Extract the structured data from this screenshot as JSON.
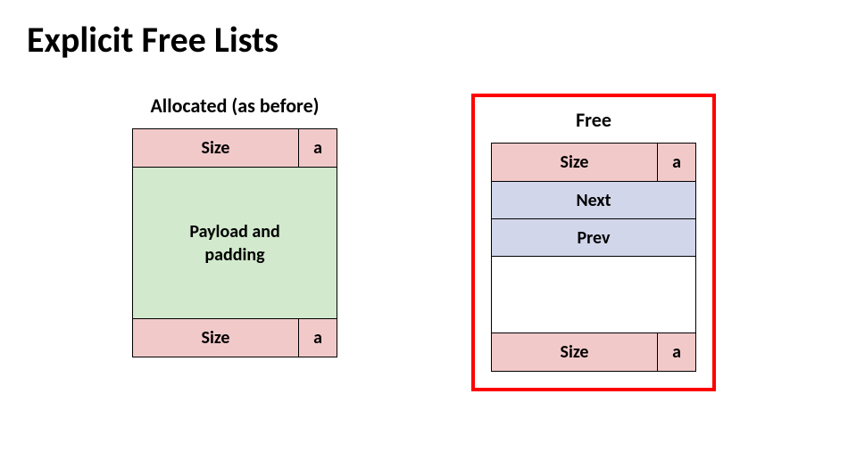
{
  "title": "Explicit Free Lists",
  "allocated": {
    "title": "Allocated (as before)",
    "header_size": "Size",
    "header_a": "a",
    "payload": "Payload and padding",
    "footer_size": "Size",
    "footer_a": "a"
  },
  "free": {
    "title": "Free",
    "header_size": "Size",
    "header_a": "a",
    "next": "Next",
    "prev": "Prev",
    "footer_size": "Size",
    "footer_a": "a"
  }
}
